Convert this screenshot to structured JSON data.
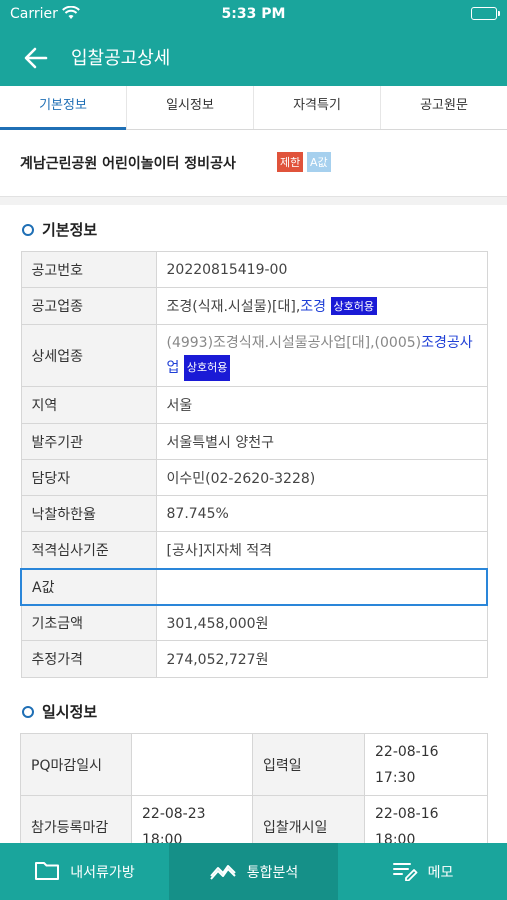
{
  "status_bar": {
    "carrier": "Carrier",
    "time": "5:33 PM"
  },
  "app_bar": {
    "title": "입찰공고상세"
  },
  "tabs": [
    {
      "label": "기본정보",
      "active": true
    },
    {
      "label": "일시정보",
      "active": false
    },
    {
      "label": "자격특기",
      "active": false
    },
    {
      "label": "공고원문",
      "active": false
    }
  ],
  "notice": {
    "title": "계남근린공원 어린이놀이터 정비공사",
    "badge_limit": "제한",
    "badge_a": "A값"
  },
  "basic_info": {
    "heading": "기본정보",
    "rows": {
      "notice_no": {
        "label": "공고번호",
        "value": "20220815419-00"
      },
      "category": {
        "label": "공고업종",
        "prefix": "조경(식재.시설물)[대],",
        "link": "조경",
        "badge": "상호허용"
      },
      "detail_category": {
        "label": "상세업종",
        "prefix": "(4993)조경식재.시설물공사업[대],(0005)",
        "link": "조경공사업",
        "badge": "상호허용"
      },
      "region": {
        "label": "지역",
        "value": "서울"
      },
      "agency": {
        "label": "발주기관",
        "value": "서울특별시 양천구"
      },
      "manager": {
        "label": "담당자",
        "value": "이수민(02-2620-3228)"
      },
      "min_rate": {
        "label": "낙찰하한율",
        "value": "87.745%"
      },
      "qualification": {
        "label": "적격심사기준",
        "value": "[공사]지자체 적격"
      },
      "a_value": {
        "label": "A값",
        "value": ""
      },
      "base_amount": {
        "label": "기초금액",
        "value": "301,458,000원"
      },
      "estimate": {
        "label": "추정가격",
        "value": "274,052,727원"
      }
    }
  },
  "schedule": {
    "heading": "일시정보",
    "rows": [
      {
        "label1": "PQ마감일시",
        "value1_date": "",
        "value1_time": "",
        "label2": "입력일",
        "value2_date": "22-08-16",
        "value2_time": "17:30"
      },
      {
        "label1": "참가등록마감",
        "value1_date": "22-08-23",
        "value1_time": "18:00",
        "label2": "입찰개시일",
        "value2_date": "22-08-16",
        "value2_time": "18:00"
      }
    ]
  },
  "bottom_nav": [
    {
      "label": "내서류가방",
      "icon": "folder-icon",
      "active": false
    },
    {
      "label": "통합분석",
      "icon": "analysis-chart-icon",
      "active": true
    },
    {
      "label": "메모",
      "icon": "memo-edit-icon",
      "active": false
    }
  ],
  "colors": {
    "primary": "#1aa59c",
    "tab_active": "#1f6fb5",
    "badge_limit": "#e0533b",
    "badge_a": "#a6d0ee",
    "amount_red": "#e24a22",
    "mutual_blue": "#1a1ad6"
  }
}
